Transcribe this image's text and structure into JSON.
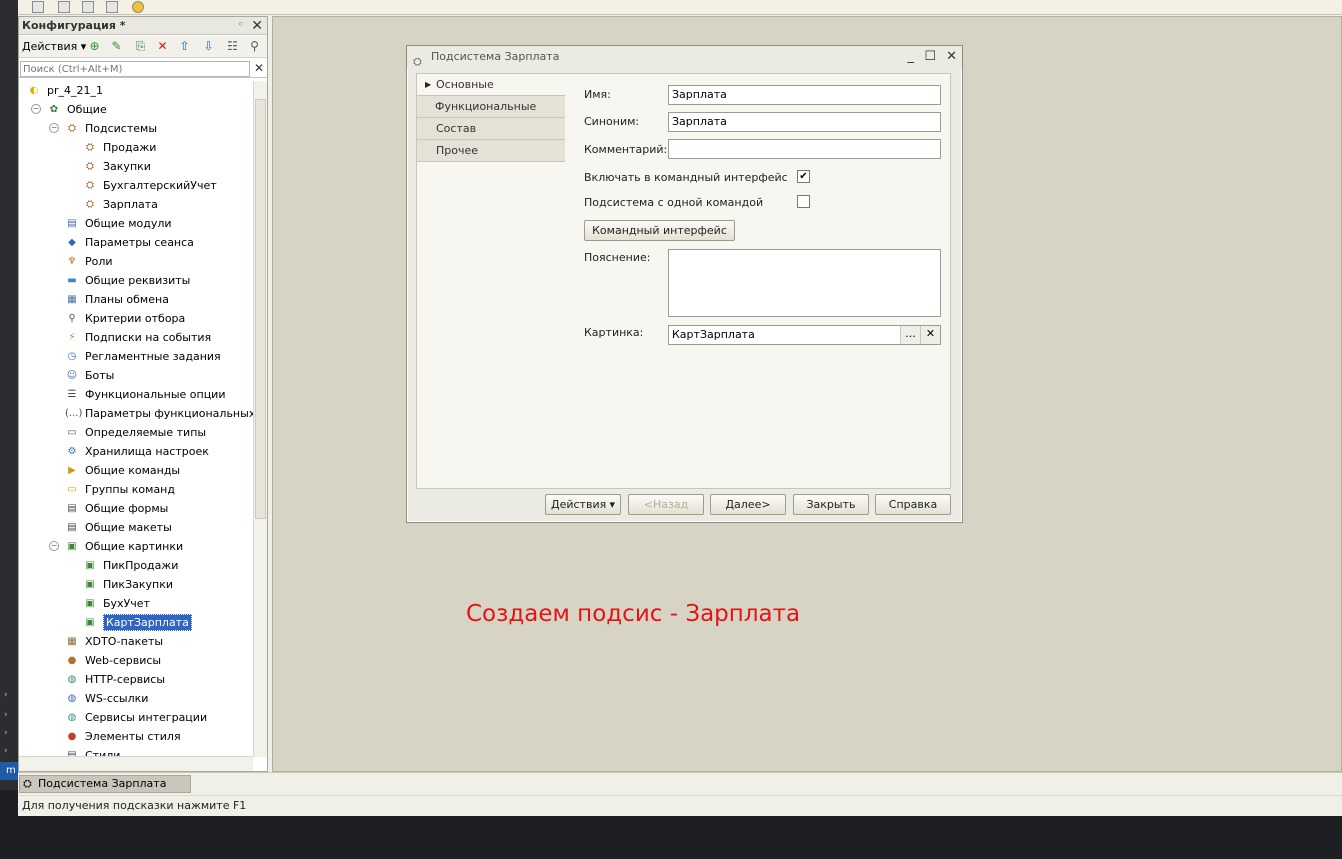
{
  "config_panel": {
    "title": "Конфигурация *",
    "actions_label": "Действия",
    "search_placeholder": "Поиск (Ctrl+Alt+M)",
    "tree": [
      {
        "label": "pr_4_21_1",
        "level": 0,
        "icon": "config-icon",
        "glyph": "◐",
        "color": "#e0b000"
      },
      {
        "label": "Общие",
        "level": 1,
        "icon": "common-icon",
        "glyph": "✿",
        "color": "#3a7a3a",
        "expanded": true
      },
      {
        "label": "Подсистемы",
        "level": 2,
        "icon": "subsystems-icon",
        "glyph": "⛭",
        "color": "#a06020",
        "expanded": true
      },
      {
        "label": "Продажи",
        "level": 3,
        "icon": "subsystem-icon",
        "glyph": "⛭",
        "color": "#a06020"
      },
      {
        "label": "Закупки",
        "level": 3,
        "icon": "subsystem-icon",
        "glyph": "⛭",
        "color": "#a06020"
      },
      {
        "label": "БухгалтерскийУчет",
        "level": 3,
        "icon": "subsystem-icon",
        "glyph": "⛭",
        "color": "#a06020"
      },
      {
        "label": "Зарплата",
        "level": 3,
        "icon": "subsystem-icon",
        "glyph": "⛭",
        "color": "#a06020"
      },
      {
        "label": "Общие модули",
        "level": 2,
        "icon": "module-icon",
        "glyph": "▤",
        "color": "#4a6aa0"
      },
      {
        "label": "Параметры сеанса",
        "level": 2,
        "icon": "session-params-icon",
        "glyph": "◆",
        "color": "#2a6ab0"
      },
      {
        "label": "Роли",
        "level": 2,
        "icon": "roles-icon",
        "glyph": "♆",
        "color": "#b07020"
      },
      {
        "label": "Общие реквизиты",
        "level": 2,
        "icon": "attributes-icon",
        "glyph": "▬",
        "color": "#3a8ac0"
      },
      {
        "label": "Планы обмена",
        "level": 2,
        "icon": "exchange-plans-icon",
        "glyph": "▦",
        "color": "#4a6aa0"
      },
      {
        "label": "Критерии отбора",
        "level": 2,
        "icon": "filter-criteria-icon",
        "glyph": "⚲",
        "color": "#5a5a5a"
      },
      {
        "label": "Подписки на события",
        "level": 2,
        "icon": "event-subscriptions-icon",
        "glyph": "⚡",
        "color": "#c08020"
      },
      {
        "label": "Регламентные задания",
        "level": 2,
        "icon": "scheduled-jobs-icon",
        "glyph": "◷",
        "color": "#3a6ab0"
      },
      {
        "label": "Боты",
        "level": 2,
        "icon": "bots-icon",
        "glyph": "☺",
        "color": "#3a6ab0"
      },
      {
        "label": "Функциональные опции",
        "level": 2,
        "icon": "functional-options-icon",
        "glyph": "☰",
        "color": "#4a4a4a"
      },
      {
        "label": "Параметры функциональных опц",
        "level": 2,
        "icon": "fo-params-icon",
        "glyph": "(...)",
        "color": "#4a4a4a"
      },
      {
        "label": "Определяемые типы",
        "level": 2,
        "icon": "defined-types-icon",
        "glyph": "▭",
        "color": "#3a6ab0"
      },
      {
        "label": "Хранилища настроек",
        "level": 2,
        "icon": "settings-storage-icon",
        "glyph": "⚙",
        "color": "#3a6ab0"
      },
      {
        "label": "Общие команды",
        "level": 2,
        "icon": "common-commands-icon",
        "glyph": "▶",
        "color": "#d09a10"
      },
      {
        "label": "Группы команд",
        "level": 2,
        "icon": "command-groups-icon",
        "glyph": "▭",
        "color": "#d09a10"
      },
      {
        "label": "Общие формы",
        "level": 2,
        "icon": "common-forms-icon",
        "glyph": "▤",
        "color": "#4a4a4a"
      },
      {
        "label": "Общие макеты",
        "level": 2,
        "icon": "common-templates-icon",
        "glyph": "▤",
        "color": "#4a4a4a"
      },
      {
        "label": "Общие картинки",
        "level": 2,
        "icon": "common-pictures-icon",
        "glyph": "▣",
        "color": "#3a8a3a",
        "expanded": true
      },
      {
        "label": "ПикПродажи",
        "level": 3,
        "icon": "picture-icon",
        "glyph": "▣",
        "color": "#3a8a3a"
      },
      {
        "label": "ПикЗакупки",
        "level": 3,
        "icon": "picture-icon",
        "glyph": "▣",
        "color": "#3a8a3a"
      },
      {
        "label": "БухУчет",
        "level": 3,
        "icon": "picture-icon",
        "glyph": "▣",
        "color": "#3a8a3a"
      },
      {
        "label": "КартЗарплата",
        "level": 3,
        "icon": "picture-icon",
        "glyph": "▣",
        "color": "#3a8a3a",
        "selected": true
      },
      {
        "label": "XDTO-пакеты",
        "level": 2,
        "icon": "xdto-icon",
        "glyph": "▦",
        "color": "#8a6a3a"
      },
      {
        "label": "Web-сервисы",
        "level": 2,
        "icon": "web-services-icon",
        "glyph": "●",
        "color": "#b07030"
      },
      {
        "label": "HTTP-сервисы",
        "level": 2,
        "icon": "http-services-icon",
        "glyph": "◍",
        "color": "#3a8a5a"
      },
      {
        "label": "WS-ссылки",
        "level": 2,
        "icon": "ws-links-icon",
        "glyph": "◍",
        "color": "#3a6ab0"
      },
      {
        "label": "Сервисы интеграции",
        "level": 2,
        "icon": "integration-services-icon",
        "glyph": "◍",
        "color": "#3a8a8a"
      },
      {
        "label": "Элементы стиля",
        "level": 2,
        "icon": "style-elements-icon",
        "glyph": "●",
        "color": "#c04020"
      },
      {
        "label": "Стили",
        "level": 2,
        "icon": "styles-icon",
        "glyph": "▤",
        "color": "#4a4a4a"
      }
    ]
  },
  "dialog": {
    "title": "Подсистема Зарплата",
    "tabs": [
      "Основные",
      "Функциональные опции",
      "Состав",
      "Прочее"
    ],
    "fields": {
      "name_label": "Имя:",
      "name_value": "Зарплата",
      "synonym_label": "Синоним:",
      "synonym_value": "Зарплата",
      "comment_label": "Комментарий:",
      "comment_value": "",
      "include_label": "Включать в командный интерфейс",
      "include_checked": "✔",
      "single_command_label": "Подсистема с одной командой",
      "command_interface_button": "Командный интерфейс",
      "explanation_label": "Пояснение:",
      "picture_label": "Картинка:",
      "picture_value": "КартЗарплата",
      "picture_pick": "...",
      "picture_clear": "✕"
    },
    "footer": {
      "actions": "Действия",
      "back": "<Назад",
      "next": "Далее>",
      "close": "Закрыть",
      "help": "Справка"
    }
  },
  "caption": "Создаем подсис - Зарплата",
  "taskbar": {
    "item": "Подсистема Зарплата"
  },
  "status_bar": "Для получения подсказки нажмите F1",
  "editor_strip": {
    "label": "m"
  }
}
